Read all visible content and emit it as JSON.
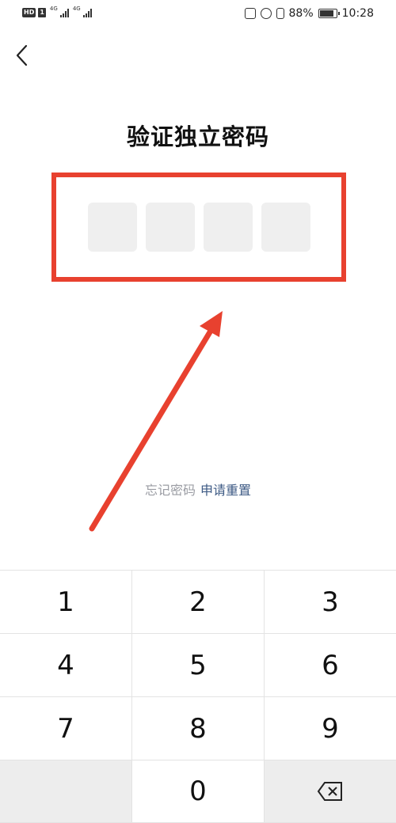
{
  "status_bar": {
    "hd": "HD",
    "sim": "1",
    "net1": "4G",
    "net2": "4G",
    "battery": "88%",
    "time": "10:28"
  },
  "page": {
    "title": "验证独立密码",
    "pin_length": 4,
    "forgot_text": "忘记密码",
    "reset_link": "申请重置"
  },
  "keypad": {
    "keys": [
      "1",
      "2",
      "3",
      "4",
      "5",
      "6",
      "7",
      "8",
      "9",
      "",
      "0",
      "delete"
    ]
  },
  "colors": {
    "highlight": "#e8412f",
    "link": "#3d5a84",
    "pin_box": "#efefef"
  }
}
